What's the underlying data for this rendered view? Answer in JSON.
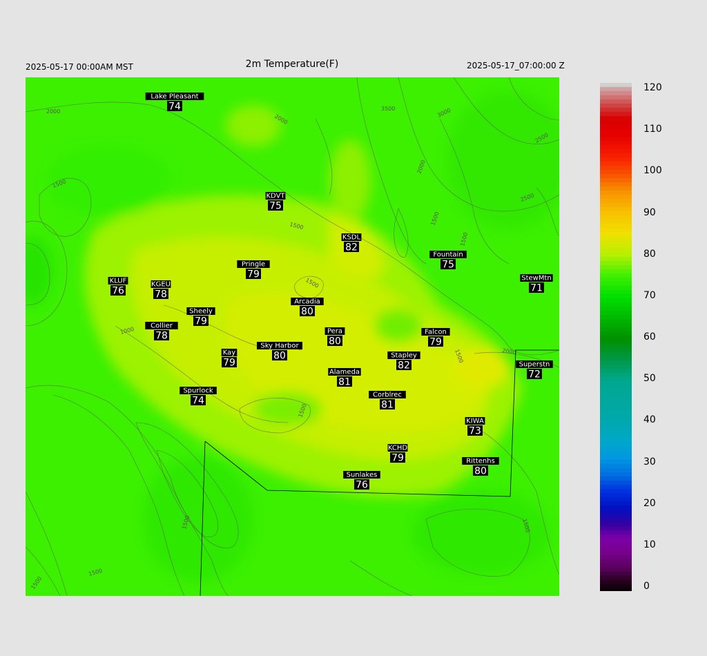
{
  "header": {
    "left": "2025-05-17 00:00AM MST",
    "title": "2m Temperature(F)",
    "right": "2025-05-17_07:00:00 Z"
  },
  "colorbar": {
    "ticks": [
      "0",
      "10",
      "20",
      "30",
      "40",
      "50",
      "60",
      "70",
      "80",
      "90",
      "100",
      "110",
      "120"
    ]
  },
  "contour_labels": [
    "2000",
    "2000",
    "3500",
    "3000",
    "2500",
    "2500",
    "1500",
    "1500",
    "2000",
    "1500",
    "1500",
    "1500",
    "1000",
    "1500",
    "2000",
    "1500",
    "1500",
    "1500",
    "1500",
    "1500"
  ],
  "stations": [
    {
      "name": "Lake Pleasant",
      "value": "74"
    },
    {
      "name": "KDVT",
      "value": "75"
    },
    {
      "name": "KSDL",
      "value": "82"
    },
    {
      "name": "Fountain",
      "value": "75"
    },
    {
      "name": "Pringle",
      "value": "79"
    },
    {
      "name": "StewMtn",
      "value": "71"
    },
    {
      "name": "KLUF",
      "value": "76"
    },
    {
      "name": "KGEU",
      "value": "78"
    },
    {
      "name": "Arcadia",
      "value": "80"
    },
    {
      "name": "Sheely",
      "value": "79"
    },
    {
      "name": "Collier",
      "value": "78"
    },
    {
      "name": "Pera",
      "value": "80"
    },
    {
      "name": "Falcon",
      "value": "79"
    },
    {
      "name": "Kay",
      "value": "79"
    },
    {
      "name": "Sky Harbor",
      "value": "80"
    },
    {
      "name": "Stapley",
      "value": "82"
    },
    {
      "name": "Superstn",
      "value": "72"
    },
    {
      "name": "Alameda",
      "value": "81"
    },
    {
      "name": "Spurlock",
      "value": "74"
    },
    {
      "name": "Corblrec",
      "value": "81"
    },
    {
      "name": "KIWA",
      "value": "73"
    },
    {
      "name": "KCHD",
      "value": "79"
    },
    {
      "name": "Rittenhs",
      "value": "80"
    },
    {
      "name": "Sunlakes",
      "value": "76"
    }
  ]
}
